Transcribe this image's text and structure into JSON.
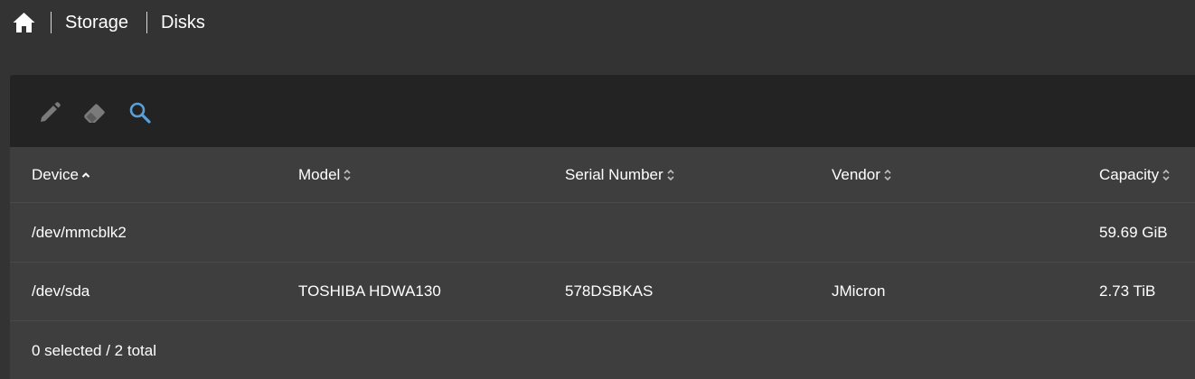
{
  "breadcrumb": {
    "home_icon": "home-icon",
    "items": [
      "Storage",
      "Disks"
    ]
  },
  "toolbar": {
    "tools": [
      {
        "icon": "pencil-icon",
        "label": "Edit",
        "color": "#7a7a7a"
      },
      {
        "icon": "eraser-icon",
        "label": "Wipe",
        "color": "#7a7a7a"
      },
      {
        "icon": "search-icon",
        "label": "Search",
        "color": "#5aa0d8"
      }
    ]
  },
  "table": {
    "columns": [
      {
        "label": "Device",
        "sort": "ascending"
      },
      {
        "label": "Model",
        "sort": "none"
      },
      {
        "label": "Serial Number",
        "sort": "none"
      },
      {
        "label": "Vendor",
        "sort": "none"
      },
      {
        "label": "Capacity",
        "sort": "none"
      }
    ],
    "rows": [
      {
        "device": "/dev/mmcblk2",
        "model": "",
        "serial": "",
        "vendor": "",
        "capacity": "59.69 GiB"
      },
      {
        "device": "/dev/sda",
        "model": "TOSHIBA HDWA130",
        "serial": "578DSBKAS",
        "vendor": "JMicron",
        "capacity": "2.73 TiB"
      }
    ]
  },
  "footer": {
    "status": "0 selected / 2 total"
  },
  "colors": {
    "background": "#333333",
    "toolbar": "#232323",
    "panel": "#3e3e3e",
    "accent": "#5aa0d8"
  }
}
